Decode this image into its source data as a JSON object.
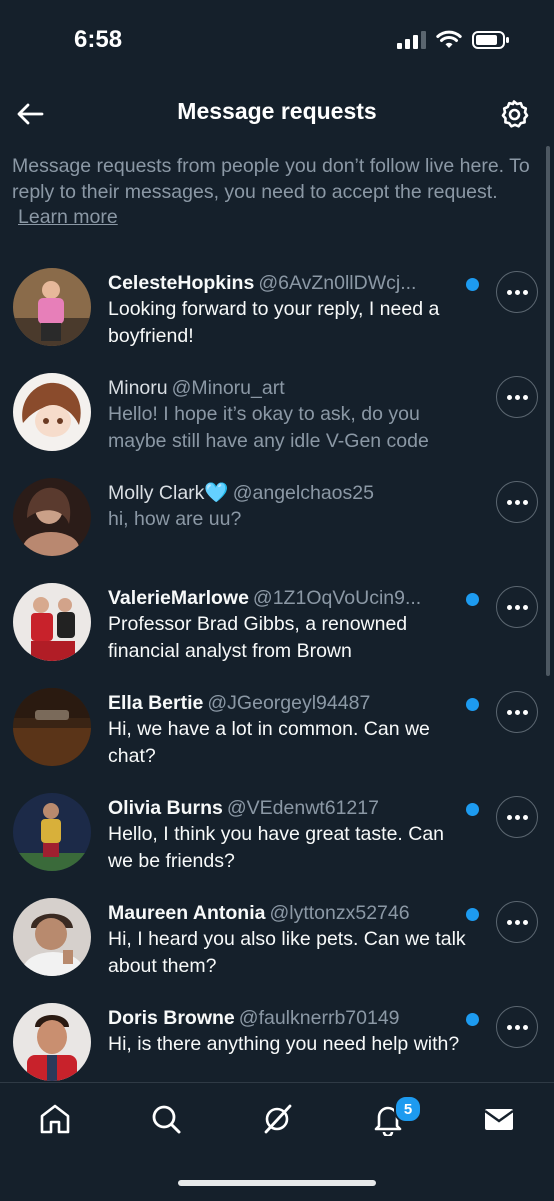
{
  "status": {
    "time": "6:58"
  },
  "header": {
    "title": "Message requests",
    "back_icon": "arrow-left-icon",
    "settings_icon": "gear-icon"
  },
  "intro": {
    "text": "Message requests from people you don’t follow live here. To reply to their messages, you need to accept the request.",
    "link": "Learn more"
  },
  "requests": [
    {
      "name": "CelesteHopkins",
      "handle": "@6AvZn0llDWcj...",
      "message": "Looking forward to your reply, I need a boyfriend!",
      "unread": true
    },
    {
      "name": "Minoru",
      "handle": "@Minoru_art",
      "message": "Hello! I hope it’s okay to ask, do you maybe still have any idle V-Gen code",
      "unread": false
    },
    {
      "name": "Molly Clark🩵",
      "handle": "@angelchaos25",
      "message": "hi, how are uu?",
      "unread": false
    },
    {
      "name": "ValerieMarlowe",
      "handle": "@1Z1OqVoUcin9...",
      "message": "Professor Brad Gibbs, a renowned financial analyst from Brown",
      "unread": true
    },
    {
      "name": "Ella Bertie",
      "handle": "@JGeorgeyl94487",
      "message": "Hi, we have a lot in common. Can we chat?",
      "unread": true
    },
    {
      "name": "Olivia Burns",
      "handle": "@VEdenwt61217",
      "message": "Hello, I think you have great taste. Can we be friends?",
      "unread": true
    },
    {
      "name": "Maureen Antonia",
      "handle": "@lyttonzx52746",
      "message": "Hi, I heard you also like pets. Can we talk about them?",
      "unread": true
    },
    {
      "name": "Doris Browne",
      "handle": "@faulknerrb70149",
      "message": "Hi, is there anything you need help with?",
      "unread": true
    }
  ],
  "tabbar": {
    "notifications_badge": "5"
  },
  "colors": {
    "background": "#15202b",
    "accent": "#1d9bf0",
    "muted": "#8b98a5"
  }
}
